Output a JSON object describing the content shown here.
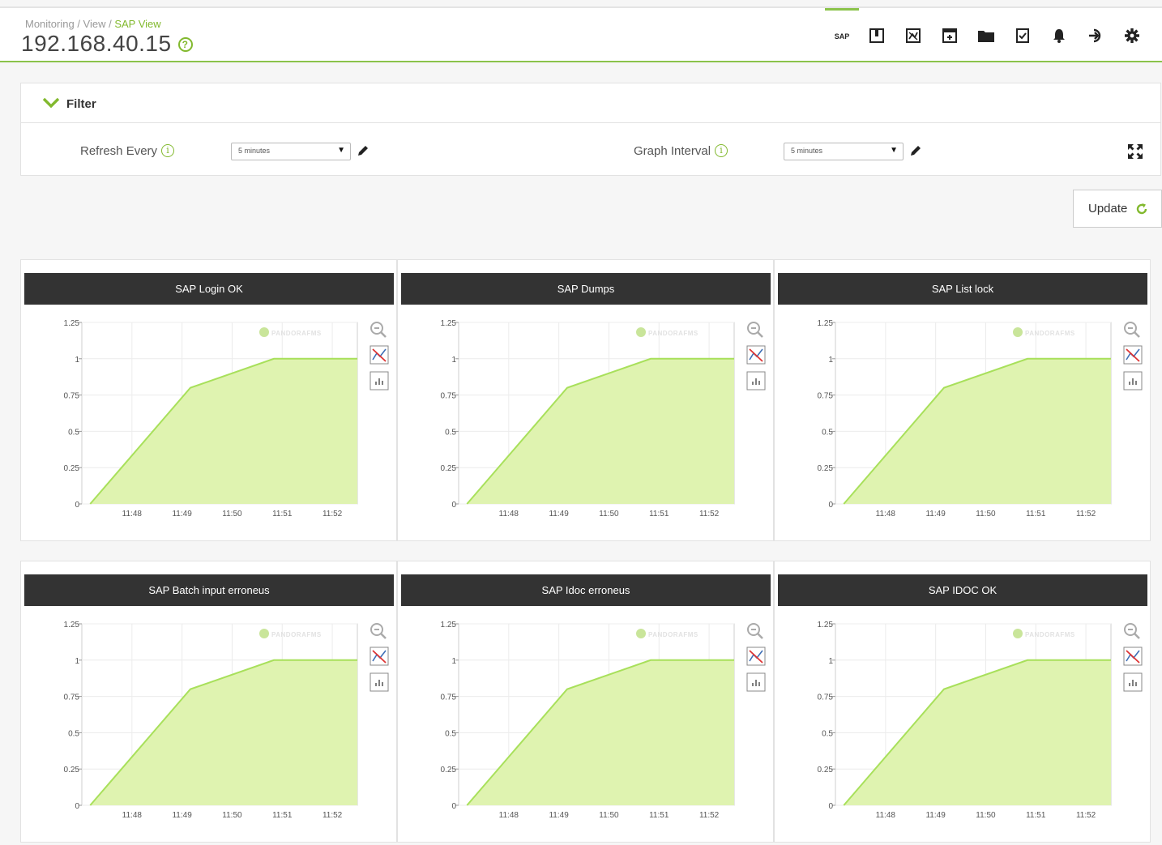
{
  "breadcrumb": {
    "part1": "Monitoring",
    "part2": "View",
    "current": "SAP View"
  },
  "page_title": "192.168.40.15",
  "toolbar": {
    "sap_label": "SAP",
    "icons": [
      "sap-tab",
      "module-icon",
      "graph-icon",
      "calendar-icon",
      "folder-icon",
      "checklist-icon",
      "bell-icon",
      "logout-icon",
      "gear-icon"
    ]
  },
  "filter": {
    "title": "Filter",
    "refresh_label": "Refresh Every",
    "refresh_value": "5 minutes",
    "graph_label": "Graph Interval",
    "graph_value": "5 minutes"
  },
  "update_button": "Update",
  "colors": {
    "accent": "#82b92e",
    "fill": "#dff3b0",
    "line": "#a8e05b",
    "title_bar": "#333333"
  },
  "watermark": "PANDORAFMS",
  "chart_data": [
    {
      "type": "area",
      "title": "SAP Login OK",
      "x": [
        "11:47:10",
        "11:49:10",
        "11:50:50",
        "11:52:30"
      ],
      "y": [
        0,
        0.8,
        1,
        1
      ],
      "xticks": [
        "11:48",
        "11:49",
        "11:50",
        "11:51",
        "11:52"
      ],
      "yticks": [
        "0",
        "0.25",
        "0.5",
        "0.75",
        "1",
        "1.25"
      ],
      "ylim": [
        0,
        1.25
      ],
      "grid": true
    },
    {
      "type": "area",
      "title": "SAP Dumps",
      "x": [
        "11:47:10",
        "11:49:10",
        "11:50:50",
        "11:52:30"
      ],
      "y": [
        0,
        0.8,
        1,
        1
      ],
      "xticks": [
        "11:48",
        "11:49",
        "11:50",
        "11:51",
        "11:52"
      ],
      "yticks": [
        "0",
        "0.25",
        "0.5",
        "0.75",
        "1",
        "1.25"
      ],
      "ylim": [
        0,
        1.25
      ],
      "grid": true
    },
    {
      "type": "area",
      "title": "SAP List lock",
      "x": [
        "11:47:10",
        "11:49:10",
        "11:50:50",
        "11:52:30"
      ],
      "y": [
        0,
        0.8,
        1,
        1
      ],
      "xticks": [
        "11:48",
        "11:49",
        "11:50",
        "11:51",
        "11:52"
      ],
      "yticks": [
        "0",
        "0.25",
        "0.5",
        "0.75",
        "1",
        "1.25"
      ],
      "ylim": [
        0,
        1.25
      ],
      "grid": true
    },
    {
      "type": "area",
      "title": "SAP Batch input erroneus",
      "x": [
        "11:47:10",
        "11:49:10",
        "11:50:50",
        "11:52:30"
      ],
      "y": [
        0,
        0.8,
        1,
        1
      ],
      "xticks": [
        "11:48",
        "11:49",
        "11:50",
        "11:51",
        "11:52"
      ],
      "yticks": [
        "0",
        "0.25",
        "0.5",
        "0.75",
        "1",
        "1.25"
      ],
      "ylim": [
        0,
        1.25
      ],
      "grid": true
    },
    {
      "type": "area",
      "title": "SAP Idoc erroneus",
      "x": [
        "11:47:10",
        "11:49:10",
        "11:50:50",
        "11:52:30"
      ],
      "y": [
        0,
        0.8,
        1,
        1
      ],
      "xticks": [
        "11:48",
        "11:49",
        "11:50",
        "11:51",
        "11:52"
      ],
      "yticks": [
        "0",
        "0.25",
        "0.5",
        "0.75",
        "1",
        "1.25"
      ],
      "ylim": [
        0,
        1.25
      ],
      "grid": true
    },
    {
      "type": "area",
      "title": "SAP IDOC OK",
      "x": [
        "11:47:10",
        "11:49:10",
        "11:50:50",
        "11:52:30"
      ],
      "y": [
        0,
        0.8,
        1,
        1
      ],
      "xticks": [
        "11:48",
        "11:49",
        "11:50",
        "11:51",
        "11:52"
      ],
      "yticks": [
        "0",
        "0.25",
        "0.5",
        "0.75",
        "1",
        "1.25"
      ],
      "ylim": [
        0,
        1.25
      ],
      "grid": true
    }
  ]
}
